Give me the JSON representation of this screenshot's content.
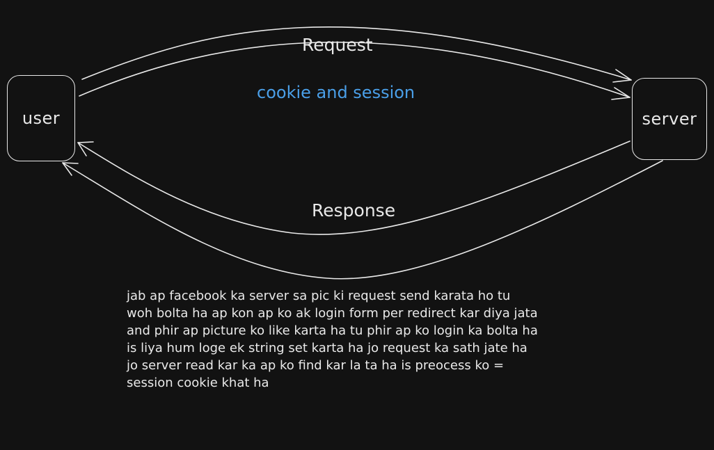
{
  "diagram": {
    "nodes": {
      "user": "user",
      "server": "server"
    },
    "edges": {
      "request": "Request",
      "response": "Response"
    },
    "title": "cookie and session",
    "note_lines": [
      "jab ap facebook ka server sa pic ki request send karata ho tu",
      "woh bolta ha ap kon ap ko ak login form per redirect kar diya jata",
      "and phir ap picture ko like karta ha tu phir ap ko login ka bolta ha",
      "is liya hum loge ek string set karta ha jo request ka sath jate ha",
      "jo server read kar ka ap ko find kar la ta ha is preocess ko =",
      "session cookie khat ha"
    ]
  },
  "colors": {
    "background": "#121212",
    "stroke": "#e9e9e9",
    "title": "#4a9fe8"
  }
}
